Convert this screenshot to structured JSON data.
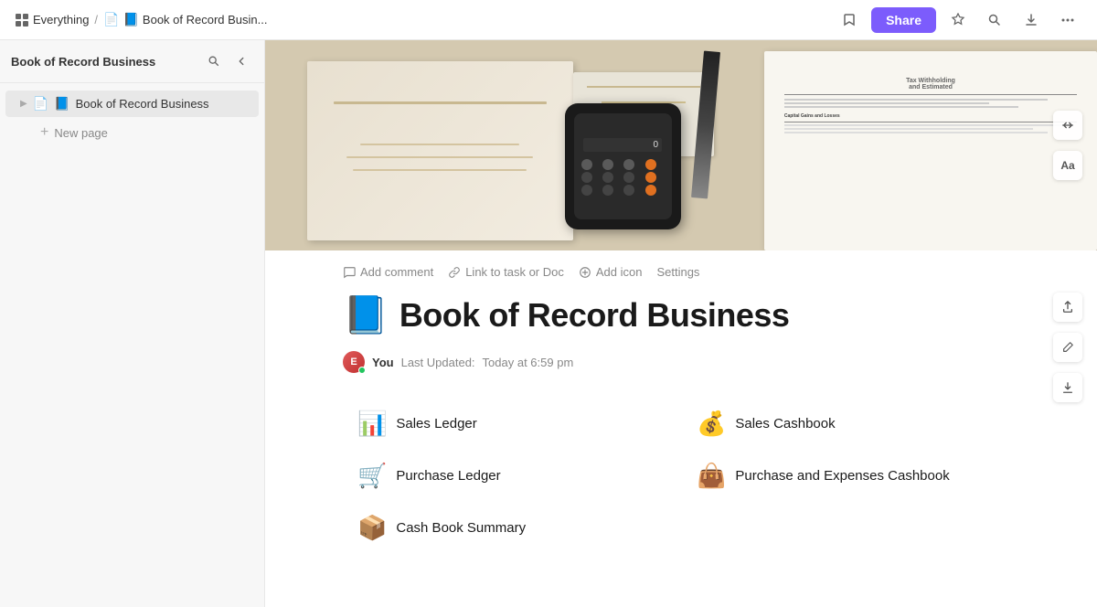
{
  "topbar": {
    "app_name": "Everything",
    "breadcrumb_sep": "/",
    "doc_icon": "📘",
    "doc_title": "Book of Record Busin...",
    "share_label": "Share"
  },
  "sidebar": {
    "title": "Book of Record Business",
    "items": [
      {
        "icon": "📘",
        "label": "Book of Record Business",
        "active": true
      }
    ],
    "new_page_label": "New page"
  },
  "toolbar": {
    "add_comment": "Add comment",
    "link_task": "Link to task or Doc",
    "add_icon": "Add icon",
    "settings": "Settings"
  },
  "page": {
    "emoji": "📘",
    "title": "Book of Record Business",
    "author_name": "You",
    "last_updated_label": "Last Updated:",
    "last_updated_time": "Today at 6:59 pm"
  },
  "documents": [
    {
      "emoji": "📊",
      "label": "Sales Ledger"
    },
    {
      "emoji": "💰",
      "label": "Sales Cashbook"
    },
    {
      "emoji": "🛒",
      "label": "Purchase Ledger"
    },
    {
      "emoji": "👜",
      "label": "Purchase and Expenses Cashbook"
    },
    {
      "emoji": "📦",
      "label": "Cash Book Summary"
    }
  ],
  "icons": {
    "bookmark": "🏷",
    "search": "🔍",
    "collapse": "◀",
    "expand_triangle": "▶",
    "star": "☆",
    "search2": "🔍",
    "download": "⬇",
    "more": "•••",
    "comment": "💬",
    "link": "🔗",
    "smiley": "😊",
    "expand_width": "↔",
    "font_size": "Aa",
    "share_link": "⬆",
    "pencil": "✏",
    "more_vert": "⬆"
  }
}
